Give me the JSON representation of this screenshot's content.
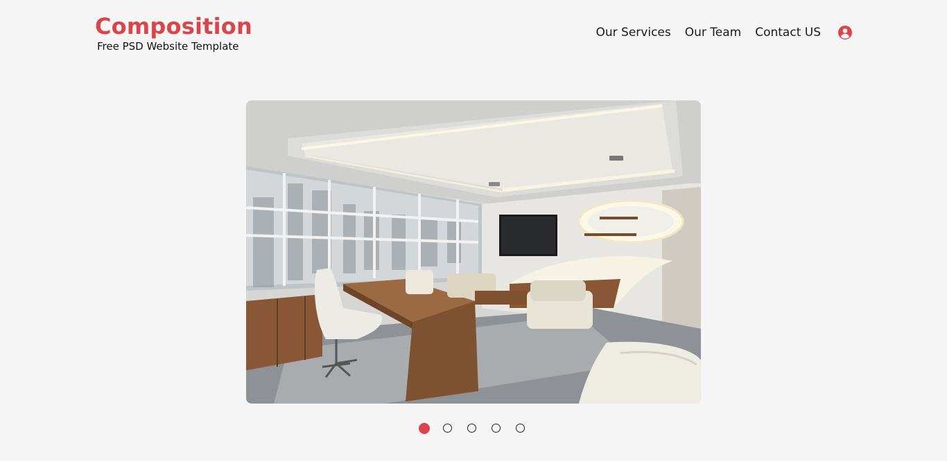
{
  "brand": {
    "title": "Composition",
    "subtitle": "Free PSD Website Template",
    "color": "#d9454a"
  },
  "nav": {
    "items": [
      {
        "label": "Our Services"
      },
      {
        "label": "Our Team"
      },
      {
        "label": "Contact US"
      }
    ],
    "user_icon": "user-circle-icon"
  },
  "slider": {
    "image": "office-interior-photo",
    "active_index": 0,
    "slide_count": 5
  }
}
